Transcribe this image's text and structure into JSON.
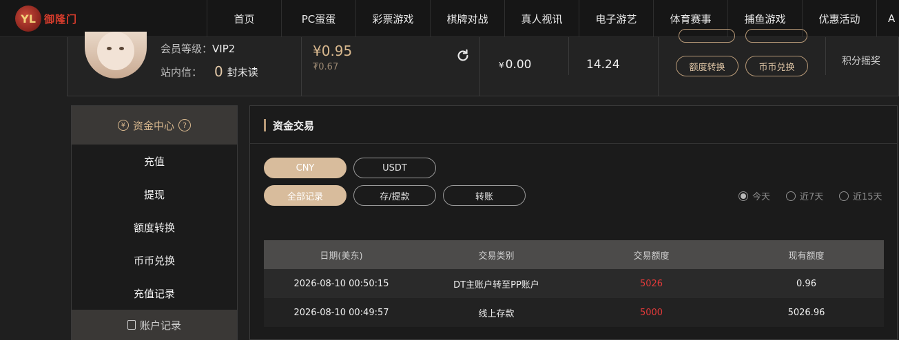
{
  "brand": {
    "name": "御隆门",
    "emblem": "YL"
  },
  "nav": {
    "items": [
      "首页",
      "PC蛋蛋",
      "彩票游戏",
      "棋牌对战",
      "真人视讯",
      "电子游艺",
      "体育赛事",
      "捕鱼游戏",
      "优惠活动",
      "A"
    ]
  },
  "user": {
    "level_label": "会员等级：",
    "level_value": "VIP2",
    "msg_label": "站内信：",
    "msg_count": "0",
    "msg_tail": "封未读",
    "balance": "¥0.95",
    "balance_sub": "₮0.67",
    "cny_symbol": "¥",
    "cny_amount": "0.00",
    "points": "14.24",
    "btn_transfer": "额度转换",
    "btn_exchange": "币币兑换",
    "lottery_label": "积分摇奖"
  },
  "sidebar": {
    "head_label": "资金中心",
    "currency_icon": "¥",
    "help_icon": "?",
    "items": [
      "充值",
      "提现",
      "额度转换",
      "币币兑换",
      "充值记录"
    ],
    "foot_label": "账户记录"
  },
  "main": {
    "title": "资金交易",
    "currency_tabs": [
      "CNY",
      "USDT"
    ],
    "type_tabs": [
      "全部记录",
      "存/提款",
      "转账"
    ],
    "ranges": [
      "今天",
      "近7天",
      "近15天"
    ],
    "selected_range": "今天"
  },
  "table": {
    "headers": [
      "日期(美东)",
      "交易类别",
      "交易额度",
      "现有额度"
    ],
    "rows": [
      {
        "date": "2026-08-10 00:50:15",
        "type": "DT主账户转至PP账户",
        "amount": "5026",
        "balance": "0.96"
      },
      {
        "date": "2026-08-10 00:49:57",
        "type": "线上存款",
        "amount": "5000",
        "balance": "5026.96"
      }
    ]
  },
  "colors": {
    "accent": "#d8bc9c",
    "gold": "#d9b98f",
    "negative": "#e23a3a",
    "background": "#1f1f1f"
  }
}
